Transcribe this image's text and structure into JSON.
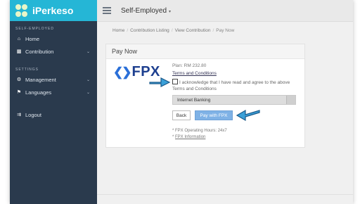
{
  "app": {
    "title": "iPerkeso"
  },
  "sidebar": {
    "section_self": "SELF-EMPLOYED",
    "section_settings": "SETTINGS",
    "items": [
      {
        "label": "Home",
        "icon": "home-icon"
      },
      {
        "label": "Contribution",
        "icon": "money-icon"
      },
      {
        "label": "Management",
        "icon": "gear-icon"
      },
      {
        "label": "Languages",
        "icon": "flag-icon"
      },
      {
        "label": "Logout",
        "icon": "logout-icon"
      }
    ]
  },
  "topbar": {
    "title": "Self-Employed"
  },
  "breadcrumb": [
    "Home",
    "Contribution Listing",
    "View Contribution",
    "Pay Now"
  ],
  "panel": {
    "title": "Pay Now",
    "fpx_text": "FPX",
    "plan": "Plan: RM 232.80",
    "terms_link": "Terms and Conditions",
    "ack_text": "I acknowledge that I have read and agree to the above Terms and Conditions",
    "bank_select": "Internet Banking",
    "back_label": "Back",
    "pay_label": "Pay with FPX",
    "hours": "* FPX Operating Hours: 24x7",
    "info_prefix": "* ",
    "info_link": "FPX Information"
  },
  "colors": {
    "brand": "#25b6d6",
    "sidebar": "#2a3a4d",
    "pay_button": "#7fb2e6",
    "callout_arrow": "#3aa0d8"
  }
}
